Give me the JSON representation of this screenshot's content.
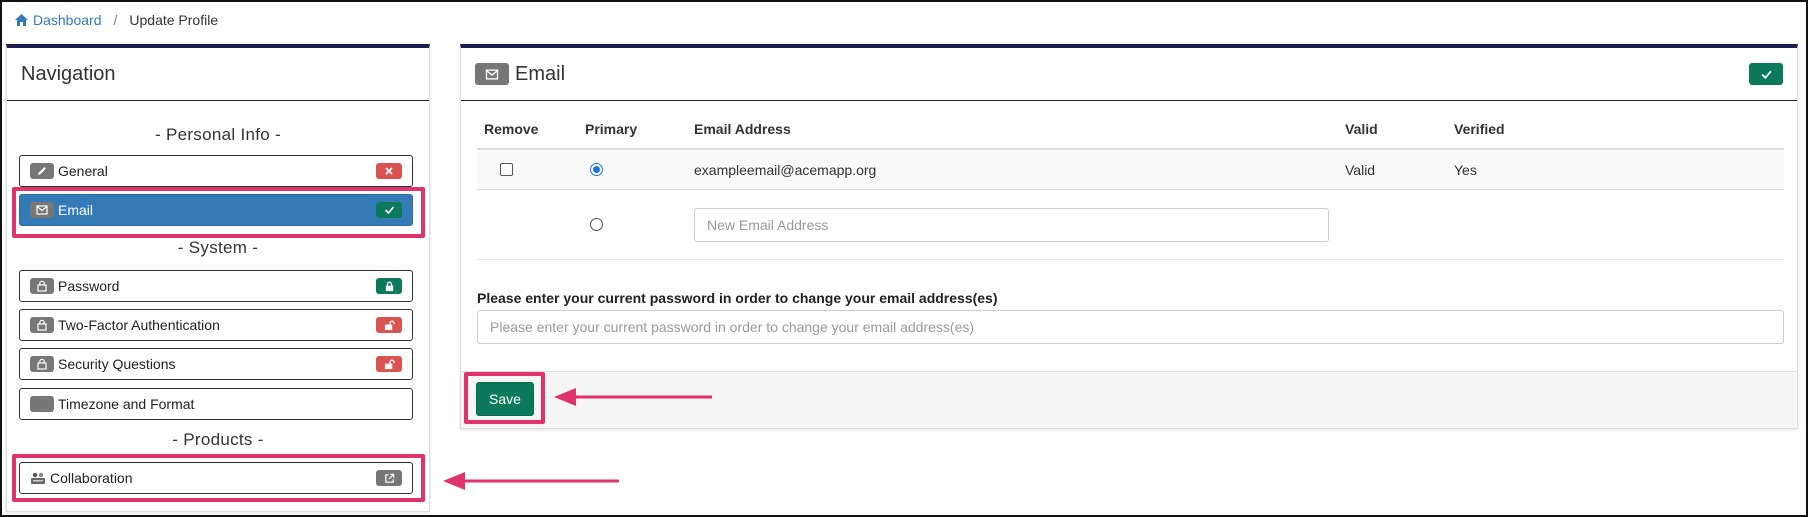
{
  "breadcrumb": {
    "home_label": "Dashboard",
    "separator": "/",
    "current": "Update Profile"
  },
  "nav": {
    "title": "Navigation",
    "sections": {
      "personal": "- Personal Info -",
      "system": "- System -",
      "products": "- Products -"
    },
    "items": [
      {
        "label": "General",
        "icon": "pencil-icon",
        "status": "x-icon",
        "status_color": "#d9534f"
      },
      {
        "label": "Email",
        "icon": "envelope-icon",
        "status": "check-icon",
        "status_color": "#0b7a5b",
        "active": true
      },
      {
        "label": "Password",
        "icon": "lock-icon",
        "status": "lock-icon",
        "status_color": "#0b7a5b"
      },
      {
        "label": "Two-Factor Authentication",
        "icon": "lock-icon",
        "status": "unlock-icon",
        "status_color": "#d9534f"
      },
      {
        "label": "Security Questions",
        "icon": "lock-icon",
        "status": "unlock-icon",
        "status_color": "#d9534f"
      },
      {
        "label": "Timezone and Format",
        "icon": "globe-icon"
      },
      {
        "label": "Collaboration",
        "icon": "people-icon",
        "status": "external-link-icon",
        "status_color": "#777"
      }
    ]
  },
  "email_panel": {
    "title": "Email",
    "status": "check-icon",
    "columns": [
      "Remove",
      "Primary",
      "Email Address",
      "Valid",
      "Verified"
    ],
    "rows": [
      {
        "remove": false,
        "primary": true,
        "email": "exampleemail@acemapp.org",
        "valid": "Valid",
        "verified": "Yes"
      }
    ],
    "new_email_placeholder": "New Email Address",
    "password_label": "Please enter your current password in order to change your email address(es)",
    "password_placeholder": "Please enter your current password in order to change your email address(es)",
    "save_label": "Save"
  },
  "colors": {
    "accent": "#337ab7",
    "success": "#0b7a5b",
    "danger": "#d9534f",
    "highlight": "#e0336b",
    "panel_top": "#1b1f4d"
  }
}
